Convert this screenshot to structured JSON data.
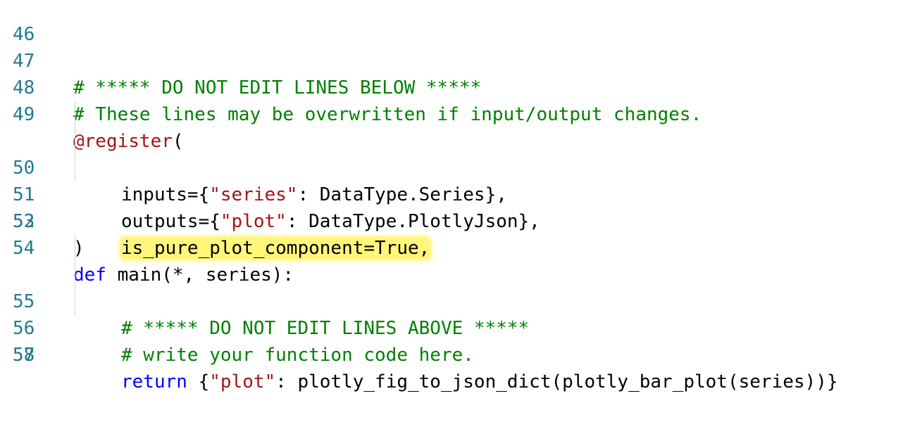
{
  "editor": {
    "highlight_color": "#fff67a",
    "line_number_color": "#237893",
    "lines": [
      {
        "number": "46",
        "text": ""
      },
      {
        "number": "47",
        "comment": "# ***** DO NOT EDIT LINES BELOW *****"
      },
      {
        "number": "48",
        "comment": "# These lines may be overwritten if input/output changes."
      },
      {
        "number": "49",
        "decorator": "@register",
        "paren": "("
      },
      {
        "number": "50",
        "pre": "inputs={",
        "string": "\"series\"",
        "post": ": DataType.Series},"
      },
      {
        "number": "51",
        "pre": "outputs={",
        "string": "\"plot\"",
        "post": ": DataType.PlotlyJson},"
      },
      {
        "number": "52",
        "highlighted": "is_pure_plot_component=True,"
      },
      {
        "number": "53",
        "text": ")"
      },
      {
        "number": "54",
        "keyword": "def",
        "rest": " main(*, series):"
      },
      {
        "number": "55",
        "comment": "# ***** DO NOT EDIT LINES ABOVE *****"
      },
      {
        "number": "56",
        "comment": "# write your function code here."
      },
      {
        "number": "57",
        "keyword": "return",
        "pre": " {",
        "string": "\"plot\"",
        "post": ": plotly_fig_to_json_dict(plotly_bar_plot(series))}"
      },
      {
        "number": "58",
        "text": ""
      }
    ]
  }
}
